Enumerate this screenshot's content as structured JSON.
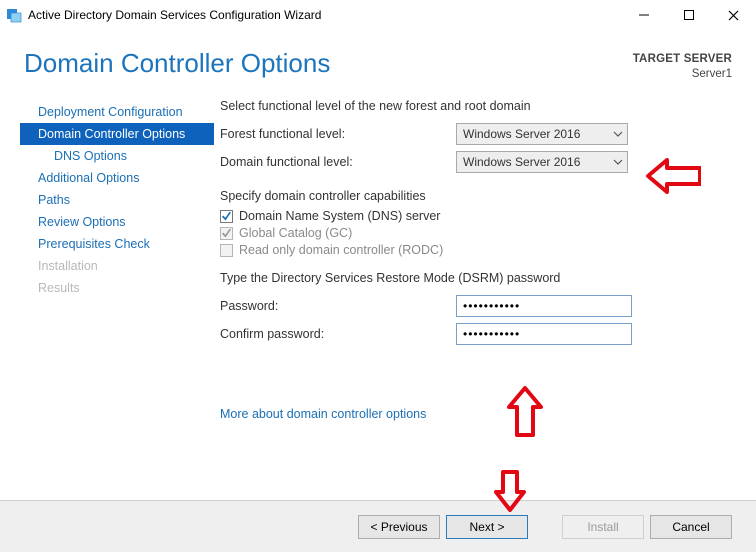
{
  "window": {
    "title": "Active Directory Domain Services Configuration Wizard"
  },
  "header": {
    "page_title": "Domain Controller Options",
    "target_label": "TARGET SERVER",
    "target_value": "Server1"
  },
  "sidebar": {
    "items": [
      {
        "label": "Deployment Configuration",
        "state": "normal"
      },
      {
        "label": "Domain Controller Options",
        "state": "selected"
      },
      {
        "label": "DNS Options",
        "state": "indent"
      },
      {
        "label": "Additional Options",
        "state": "normal"
      },
      {
        "label": "Paths",
        "state": "normal"
      },
      {
        "label": "Review Options",
        "state": "normal"
      },
      {
        "label": "Prerequisites Check",
        "state": "normal"
      },
      {
        "label": "Installation",
        "state": "disabled"
      },
      {
        "label": "Results",
        "state": "disabled"
      }
    ]
  },
  "main": {
    "functional_section": "Select functional level of the new forest and root domain",
    "forest_label": "Forest functional level:",
    "forest_value": "Windows Server 2016",
    "domain_label": "Domain functional level:",
    "domain_value": "Windows Server 2016",
    "caps_heading": "Specify domain controller capabilities",
    "caps": [
      {
        "label": "Domain Name System (DNS) server",
        "checked": true,
        "enabled": true
      },
      {
        "label": "Global Catalog (GC)",
        "checked": true,
        "enabled": false
      },
      {
        "label": "Read only domain controller (RODC)",
        "checked": false,
        "enabled": false
      }
    ],
    "dsrm_heading": "Type the Directory Services Restore Mode (DSRM) password",
    "password_label": "Password:",
    "password_value": "•••••••••••",
    "confirm_label": "Confirm password:",
    "confirm_value": "•••••••••••",
    "more_link": "More about domain controller options"
  },
  "footer": {
    "previous": "< Previous",
    "next": "Next >",
    "install": "Install",
    "cancel": "Cancel"
  }
}
